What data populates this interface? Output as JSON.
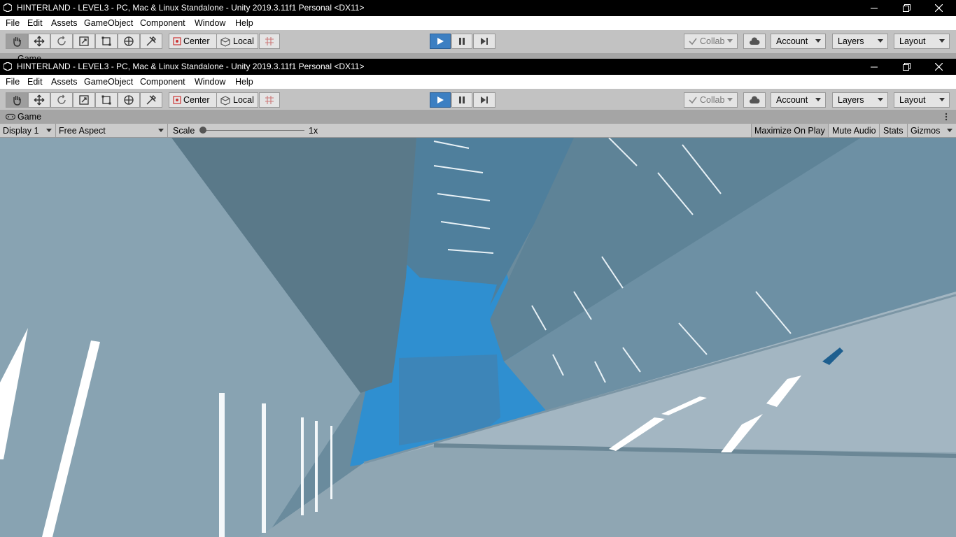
{
  "window": {
    "title": "HINTERLAND - LEVEL3 - PC, Mac & Linux Standalone - Unity 2019.3.11f1 Personal <DX11>"
  },
  "menu": [
    "File",
    "Edit",
    "Assets",
    "GameObject",
    "Component",
    "Window",
    "Help"
  ],
  "toolbar": {
    "tools": [
      "hand-tool-icon",
      "move-tool-icon",
      "rotate-tool-icon",
      "scale-tool-icon",
      "rect-tool-icon",
      "transform-tool-icon",
      "custom-tool-icon"
    ],
    "pivot_center": "Center",
    "pivot_local": "Local",
    "collab": "Collab",
    "account": "Account",
    "layers": "Layers",
    "layout": "Layout"
  },
  "game": {
    "tab_label": "Game",
    "display": "Display 1",
    "aspect": "Free Aspect",
    "scale_label": "Scale",
    "scale_value": "1x",
    "maximize": "Maximize On Play",
    "mute": "Mute Audio",
    "stats": "Stats",
    "gizmos": "Gizmos"
  },
  "colors": {
    "play_active": "#3c7fc2",
    "sky_blue": "#2f8fd0",
    "building": "#7a9aad"
  }
}
